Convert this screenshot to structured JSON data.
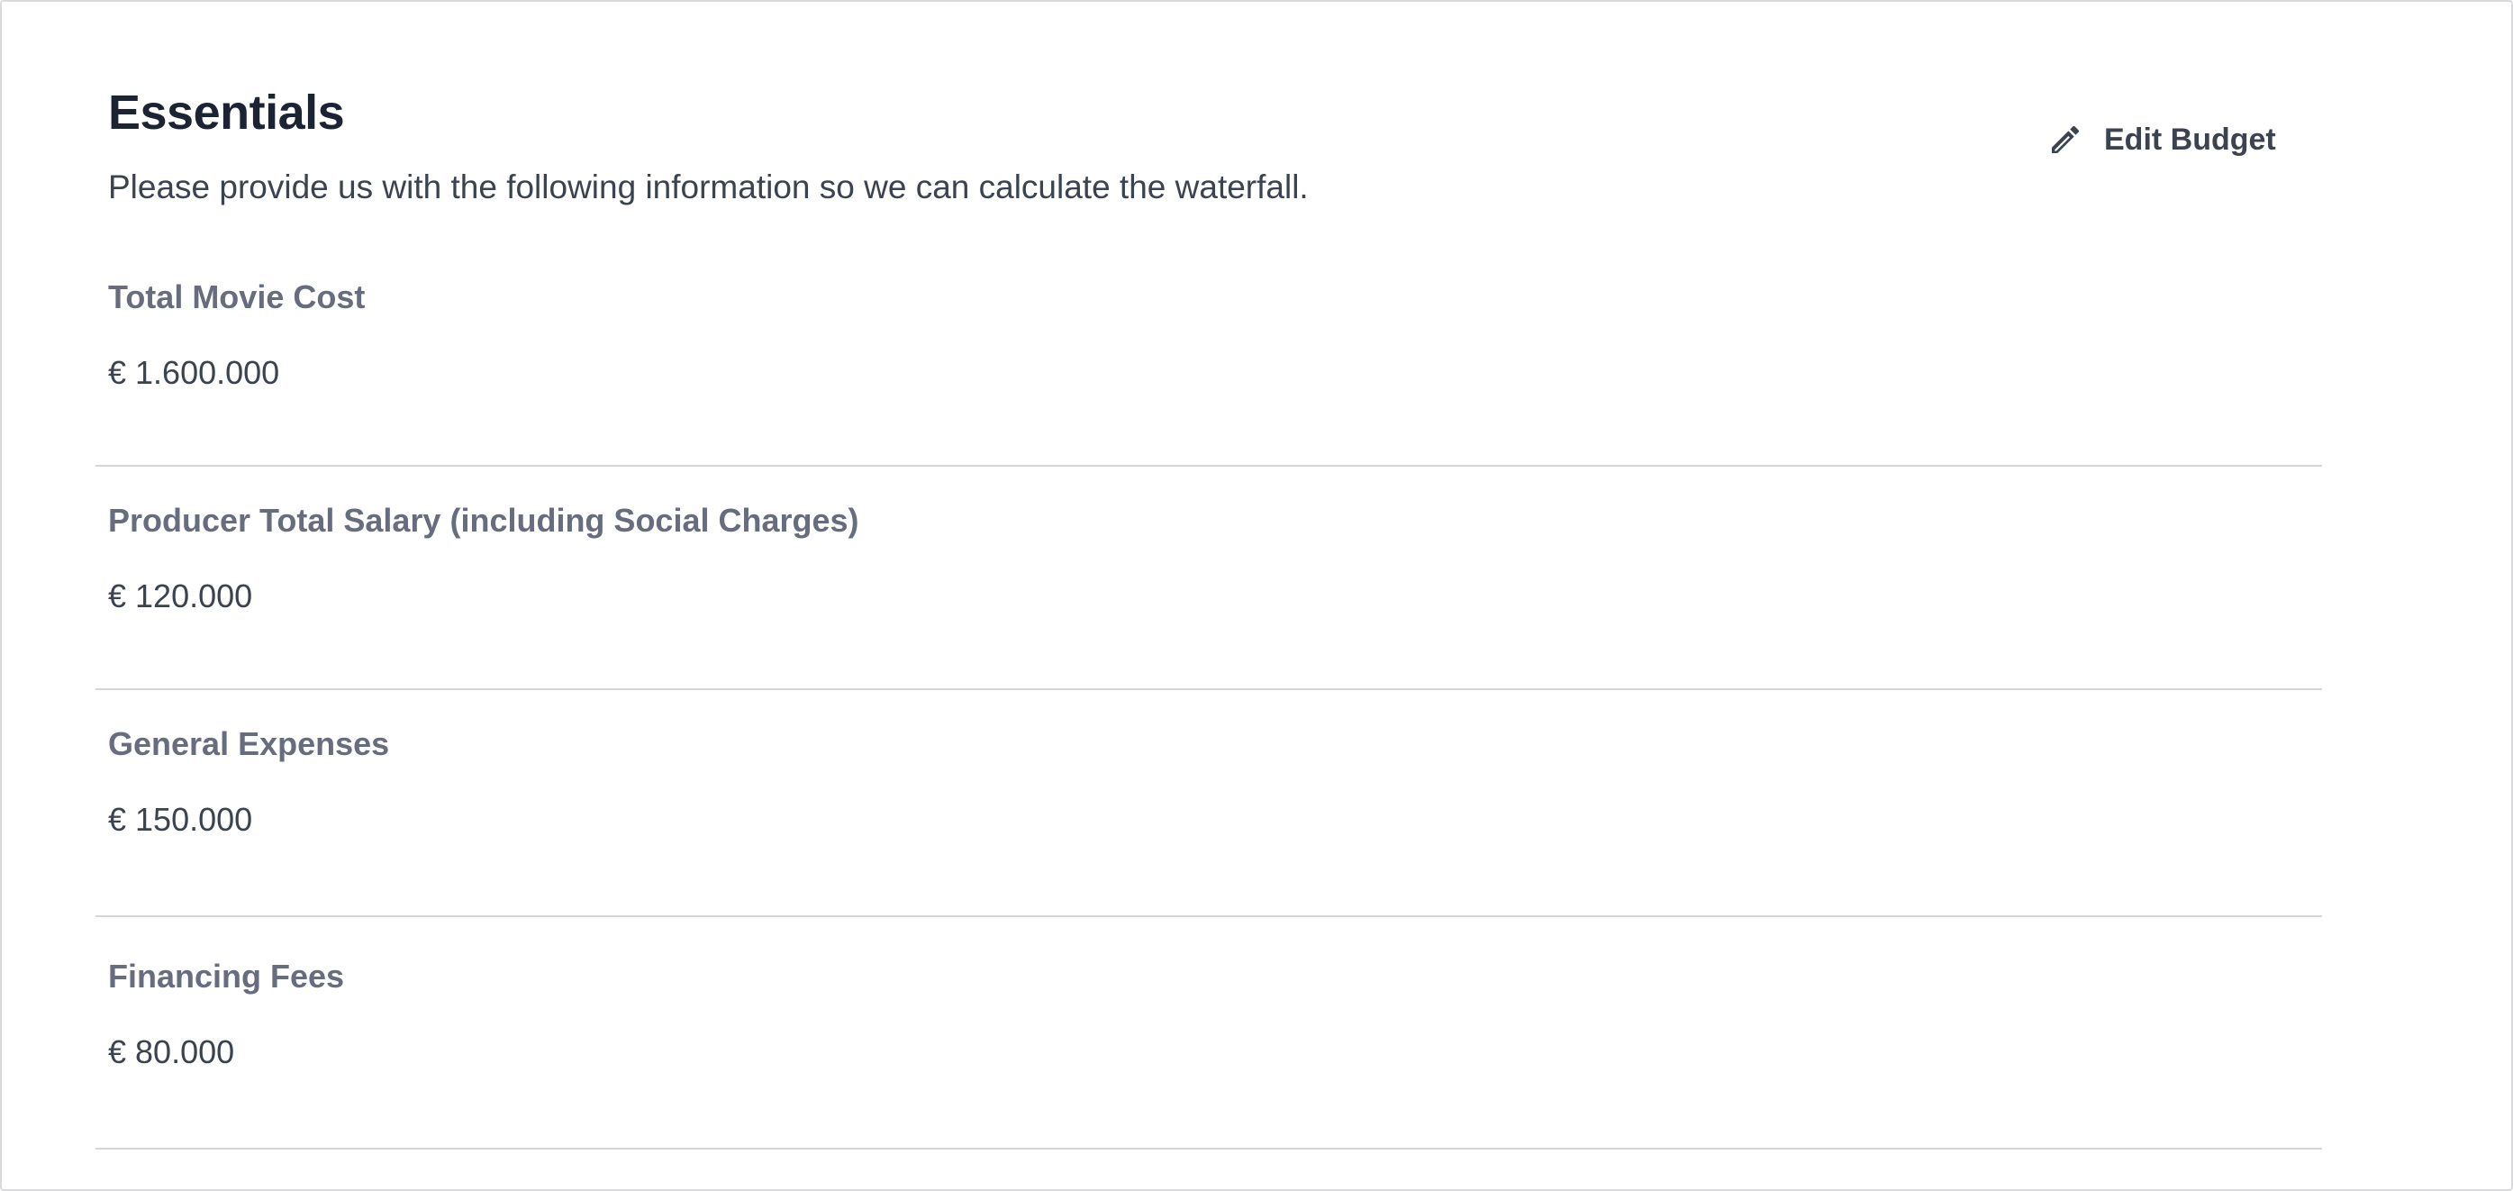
{
  "header": {
    "title": "Essentials",
    "subtitle": "Please provide us with the following information so we can calculate the waterfall."
  },
  "actions": {
    "edit_budget_label": "Edit Budget",
    "edit_budget_icon": "pencil-icon"
  },
  "fields": [
    {
      "label": "Total Movie Cost",
      "value": "€ 1.600.000"
    },
    {
      "label": "Producer Total Salary (including Social Charges)",
      "value": "€ 120.000"
    },
    {
      "label": "General Expenses",
      "value": "€ 150.000"
    },
    {
      "label": "Financing Fees",
      "value": "€ 80.000"
    }
  ],
  "colors": {
    "title": "#1c2434",
    "label": "#676c7e",
    "text": "#3b4250",
    "divider": "#d6d6da"
  }
}
